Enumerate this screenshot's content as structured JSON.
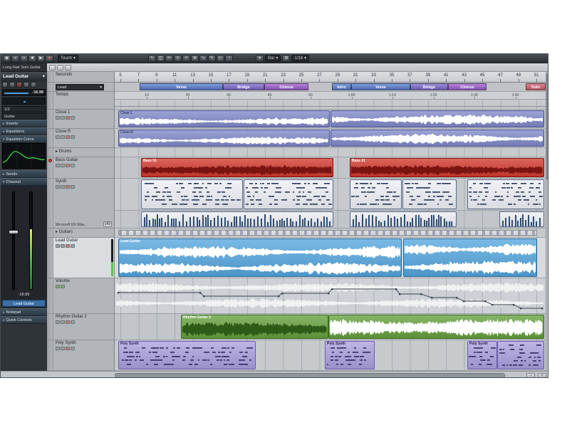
{
  "colors": {
    "accent": "#3f8ec8",
    "audio_event": "#8089c9",
    "audio_event_border": "#4a5296",
    "bass_event": "#d23a2e",
    "bass_event_border": "#7a120e",
    "lead_event": "#55a6de",
    "lead_event_border": "#2a6a9a",
    "rhythm_event": "#66a03e",
    "rhythm_event_border": "#3c6e22",
    "poly_event": "#a79ddb",
    "poly_event_border": "#6a5ab0",
    "midi_part": "#eceef4",
    "midi_part_border": "#5a6a8a",
    "midi_note": "#2a3a5a",
    "eq_curve": "#3ec24f"
  },
  "header": {
    "project_track": "Long Hair Solo Guitar"
  },
  "toolbar": {
    "transport": [
      {
        "name": "activate-project-button",
        "glyph": "◉"
      },
      {
        "name": "rewind-button",
        "glyph": "«"
      },
      {
        "name": "forward-button",
        "glyph": "»"
      },
      {
        "name": "stop-button",
        "glyph": "■"
      },
      {
        "name": "play-button",
        "glyph": "▶"
      },
      {
        "name": "record-button",
        "glyph": "●"
      }
    ],
    "automation_mode": "Touch",
    "tools": [
      {
        "name": "object-selection-tool",
        "glyph": "↖"
      },
      {
        "name": "range-selection-tool",
        "glyph": "◫"
      },
      {
        "name": "split-tool",
        "glyph": "✂"
      },
      {
        "name": "glue-tool",
        "glyph": "≡"
      },
      {
        "name": "erase-tool",
        "glyph": "×"
      },
      {
        "name": "zoom-tool",
        "glyph": "⊕"
      },
      {
        "name": "mute-tool",
        "glyph": "∿"
      },
      {
        "name": "draw-tool",
        "glyph": "✎"
      },
      {
        "name": "play-tool",
        "glyph": "▷"
      },
      {
        "name": "color-tool",
        "glyph": "◔"
      }
    ],
    "icons": {
      "caret": "▾",
      "snap": "∗",
      "grid": "⊞"
    },
    "snap_label": "Bar",
    "grid_label": "1/16"
  },
  "inspector": {
    "title": "Lead Guitar",
    "volume_value": "-16.99",
    "routing": "1/2",
    "category": "Guitar",
    "sections": [
      {
        "label": "Inserts"
      },
      {
        "label": "Equalizers"
      },
      {
        "label": "Equalizer Curve"
      },
      {
        "label": "Sends"
      },
      {
        "label": "Channel"
      },
      {
        "label": "Notepad"
      },
      {
        "label": "Quick Controls"
      }
    ],
    "channel": {
      "value": "-16.99",
      "name": "Lead Guitar"
    }
  },
  "ruler": {
    "bars": [
      "5",
      "7",
      "9",
      "11",
      "13",
      "15",
      "17",
      "19",
      "21",
      "23",
      "25",
      "27",
      "29",
      "31",
      "33",
      "35",
      "37",
      "39",
      "41",
      "43",
      "45",
      "47",
      "49",
      "51"
    ],
    "seconds": [
      "10",
      "20",
      "30",
      "40",
      "50",
      "1:00",
      "1:10",
      "1:20",
      "1:30",
      "1:40"
    ]
  },
  "markers": [
    {
      "label": "Verse",
      "color": "#5b7fd4"
    },
    {
      "label": "Bridge",
      "color": "#7e6bd0"
    },
    {
      "label": "Chorus",
      "color": "#a05fd0"
    },
    {
      "label": "Intro",
      "color": "#5b7fd4"
    },
    {
      "label": "Verse",
      "color": "#5b7fd4"
    },
    {
      "label": "Bridge",
      "color": "#7e6bd0"
    },
    {
      "label": "Chorus",
      "color": "#a05fd0"
    },
    {
      "label": "Solo",
      "color": "#d4606e"
    }
  ],
  "tracks": [
    {
      "name": "Seconds",
      "kind": "ruler"
    },
    {
      "name": "Lead",
      "kind": "marker"
    },
    {
      "name": "Tempo",
      "kind": "tempo"
    },
    {
      "name": "Close 1",
      "kind": "audio"
    },
    {
      "name": "Close R",
      "kind": "audio"
    },
    {
      "name": "Drums",
      "kind": "folder"
    },
    {
      "name": "Bass Guitar",
      "kind": "audio",
      "armed": true
    },
    {
      "name": "Synth",
      "kind": "midi",
      "routing": "Microsoft GS Wav...",
      "routing_value": "149"
    },
    {
      "name": "Guitars",
      "kind": "folder"
    },
    {
      "name": "Lead Guitar",
      "kind": "audio",
      "selected": true
    },
    {
      "name": "Volume",
      "kind": "automation"
    },
    {
      "name": "Rhythm Guitar 2",
      "kind": "audio"
    },
    {
      "name": "Poly Synth",
      "kind": "midi"
    }
  ],
  "events": {
    "close1": "Close 1",
    "close_r": "Close R",
    "bass": "Bass 01",
    "lead": "Lead Guitar",
    "rhythm": "Rhythm Guitar 2",
    "poly": "Poly Synth"
  }
}
